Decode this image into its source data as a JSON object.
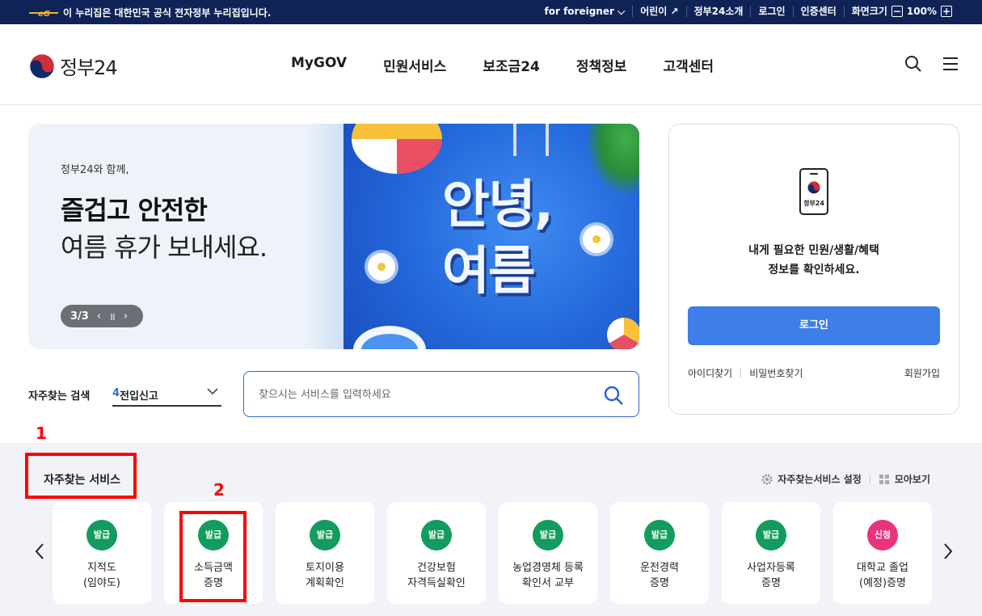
{
  "topbar": {
    "gov_notice": "이 누리집은 대한민국 공식 전자정부 누리집입니다.",
    "links": [
      "for foreigner",
      "어린이",
      "정부24소개",
      "로그인",
      "인증센터",
      "화면크기"
    ],
    "zoom_minus": "−",
    "zoom_value": "100%",
    "zoom_plus": "+"
  },
  "header": {
    "logo_text": "정부24",
    "nav": [
      "MyGOV",
      "민원서비스",
      "보조금24",
      "정책정보",
      "고객센터"
    ]
  },
  "banner": {
    "subtitle": "정부24와 함께,",
    "title_line1": "즐겁고 안전한",
    "title_line2": "여름 휴가 보내세요.",
    "pager": "3/3",
    "prev": "‹",
    "pause": "॥",
    "next": "›",
    "art_text_line1": "안녕,",
    "art_text_line2": "여름"
  },
  "login": {
    "phone_label": "정부24",
    "message_line1": "내게 필요한 민원/생활/혜택",
    "message_line2": "정보를 확인하세요.",
    "button": "로그인",
    "find_id": "아이디찾기",
    "find_pw": "비밀번호찾기",
    "signup": "회원가입"
  },
  "search": {
    "freq_label": "자주찾는 검색",
    "freq_num": "4",
    "freq_value": "전입신고",
    "placeholder": "찾으시는 서비스를 입력하세요"
  },
  "services": {
    "title": "자주찾는 서비스",
    "settings": "자주찾는서비스 설정",
    "view_all": "모아보기",
    "cards": [
      {
        "badge": "발급",
        "name": "지적도\n(임야도)"
      },
      {
        "badge": "발급",
        "name": "소득금액\n증명"
      },
      {
        "badge": "발급",
        "name": "토지이용\n계획확인"
      },
      {
        "badge": "발급",
        "name": "건강보험\n자격득실확인"
      },
      {
        "badge": "발급",
        "name": "농업경영체 등록\n확인서 교부"
      },
      {
        "badge": "발급",
        "name": "운전경력\n증명"
      },
      {
        "badge": "발급",
        "name": "사업자등록\n증명"
      },
      {
        "badge": "신청",
        "name": "대학교 졸업\n(예정)증명"
      }
    ]
  },
  "annotations": {
    "first": "1",
    "second": "2"
  },
  "colors": {
    "topbar": "#0f2357",
    "accent": "#3d7ee8",
    "issue_badge": "#139c5d",
    "apply_badge": "#e8337d",
    "annotation": "#ff0000"
  }
}
